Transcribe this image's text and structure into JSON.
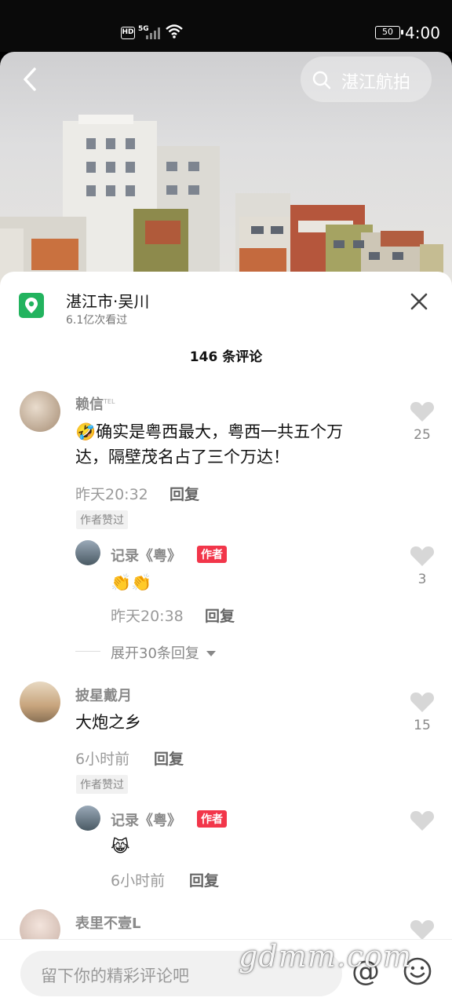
{
  "status_bar": {
    "hd": "HD",
    "network": "5G",
    "battery": "50",
    "time": "4:00"
  },
  "header": {
    "search_text": "湛江航拍"
  },
  "location": {
    "title": "湛江市·吴川",
    "views": "6.1亿次看过"
  },
  "comments_count": "146 条评论",
  "comments": [
    {
      "user": "赖信",
      "user_sup": "TEL",
      "text_line1": "确实是粤西最大，粤西一共五个万",
      "text_line2": "达，隔壁茂名占了三个万达！",
      "time": "昨天20:32",
      "reply_label": "回复",
      "liked_tag": "作者赞过",
      "likes": "25",
      "reply": {
        "user": "记录《粤》",
        "author_tag": "作者",
        "emoji": "👏👏",
        "time": "昨天20:38",
        "reply_label": "回复",
        "likes": "3"
      },
      "expand": "展开30条回复"
    },
    {
      "user": "披星戴月",
      "text_line1": "大炮之乡",
      "time": "6小时前",
      "reply_label": "回复",
      "liked_tag": "作者赞过",
      "likes": "15",
      "reply": {
        "user": "记录《粤》",
        "author_tag": "作者",
        "emoji": "😹",
        "time": "6小时前",
        "reply_label": "回复",
        "likes": ""
      }
    },
    {
      "user": "表里不壹L"
    }
  ],
  "input": {
    "placeholder": "留下你的精彩评论吧",
    "at_symbol": "@"
  },
  "watermark": "gdmm.com",
  "colors": {
    "accent": "#f2364a",
    "location_green": "#22b35e"
  }
}
